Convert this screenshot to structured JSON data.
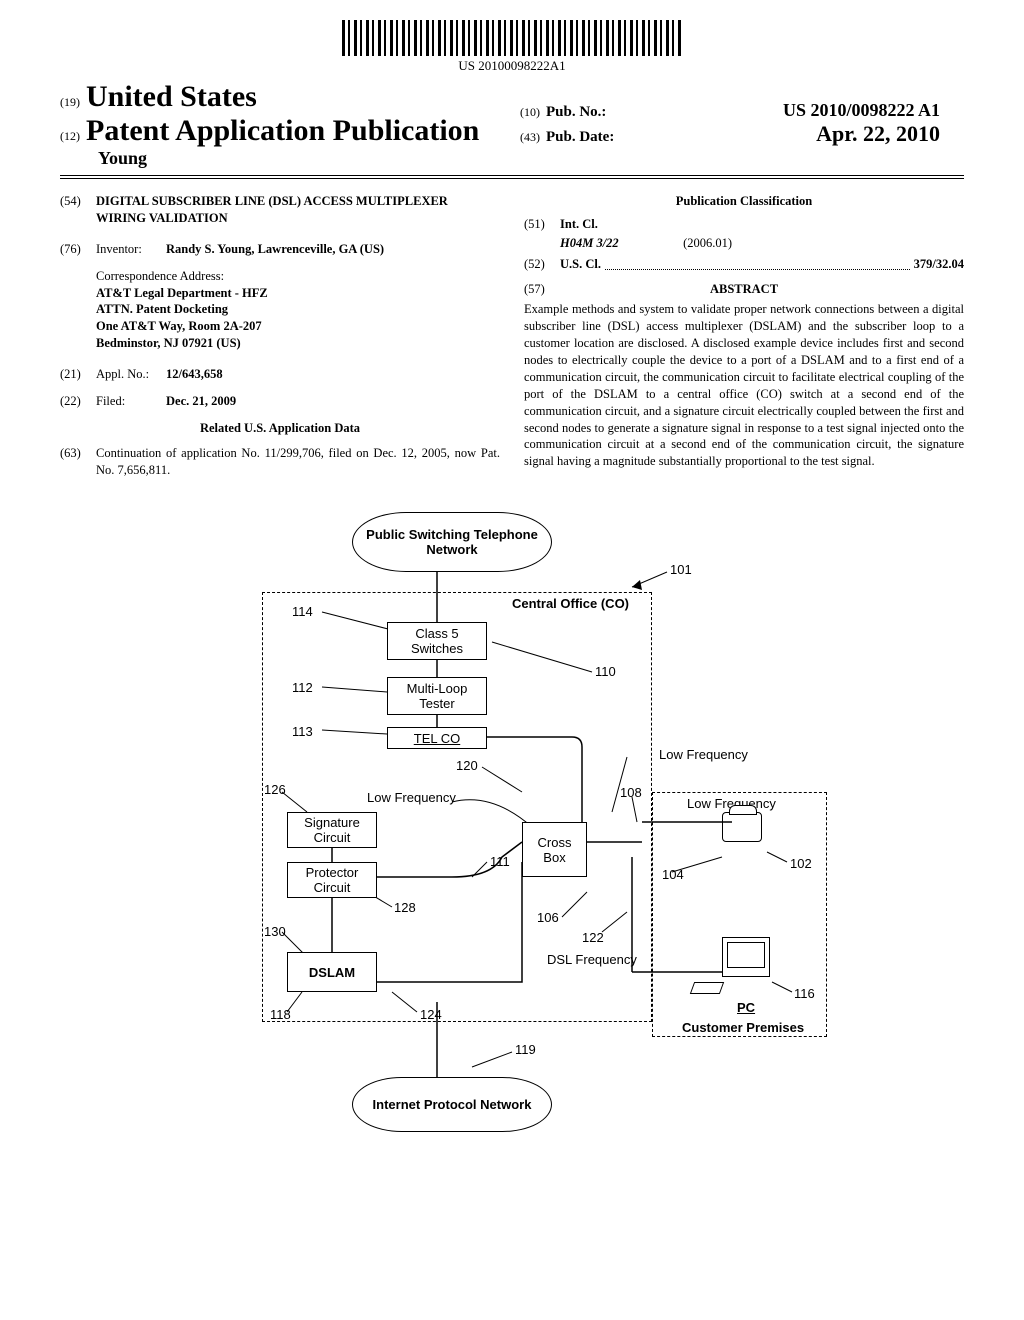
{
  "barcode_text": "US 20100098222A1",
  "header": {
    "country_code": "(19)",
    "country": "United States",
    "pub_type_code": "(12)",
    "pub_type": "Patent Application Publication",
    "inventor_surname": "Young",
    "pub_no_code": "(10)",
    "pub_no_label": "Pub. No.:",
    "pub_no": "US 2010/0098222 A1",
    "pub_date_code": "(43)",
    "pub_date_label": "Pub. Date:",
    "pub_date": "Apr. 22, 2010"
  },
  "left": {
    "title_code": "(54)",
    "title": "DIGITAL SUBSCRIBER LINE (DSL) ACCESS MULTIPLEXER WIRING VALIDATION",
    "inventor_code": "(76)",
    "inventor_label": "Inventor:",
    "inventor": "Randy S. Young, Lawrenceville, GA (US)",
    "corr_label": "Correspondence Address:",
    "corr_1": "AT&T Legal Department - HFZ",
    "corr_2": "ATTN. Patent Docketing",
    "corr_3": "One AT&T Way, Room 2A-207",
    "corr_4": "Bedminstor, NJ 07921 (US)",
    "appl_code": "(21)",
    "appl_label": "Appl. No.:",
    "appl_no": "12/643,658",
    "filed_code": "(22)",
    "filed_label": "Filed:",
    "filed": "Dec. 21, 2009",
    "related_head": "Related U.S. Application Data",
    "related_code": "(63)",
    "related": "Continuation of application No. 11/299,706, filed on Dec. 12, 2005, now Pat. No. 7,656,811."
  },
  "right": {
    "pc_head": "Publication Classification",
    "intcl_code": "(51)",
    "intcl_label": "Int. Cl.",
    "intcl_class": "H04M 3/22",
    "intcl_date": "(2006.01)",
    "uscl_code": "(52)",
    "uscl_label": "U.S. Cl.",
    "uscl_val": "379/32.04",
    "abstract_code": "(57)",
    "abstract_head": "ABSTRACT",
    "abstract": "Example methods and system to validate proper network connections between a digital subscriber line (DSL) access multiplexer (DSLAM) and the subscriber loop to a customer location are disclosed. A disclosed example device includes first and second nodes to electrically couple the device to a port of a DSLAM and to a first end of a communication circuit, the communication circuit to facilitate electrical coupling of the port of the DSLAM to a central office (CO) switch at a second end of the communication circuit, and a signature circuit electrically coupled between the first and second nodes to generate a signature signal in response to a test signal injected onto the communication circuit at a second end of the communication circuit, the signature signal having a magnitude substantially proportional to the test signal."
  },
  "diagram": {
    "pstn": "Public Switching Telephone Network",
    "co_label": "Central Office (CO)",
    "class5": "Class 5 Switches",
    "mlt": "Multi-Loop Tester",
    "telco": "TEL CO",
    "sig": "Signature Circuit",
    "prot": "Protector Circuit",
    "dslam": "DSLAM",
    "crossbox": "Cross Box",
    "ipn": "Internet Protocol Network",
    "lowfreq": "Low Frequency",
    "dslfreq": "DSL Frequency",
    "cust": "Customer Premises",
    "pc": "PC",
    "ref": {
      "r101": "101",
      "r114": "114",
      "r112": "112",
      "r113": "113",
      "r110": "110",
      "r126": "126",
      "r120": "120",
      "r111": "111",
      "r108": "108",
      "r106": "106",
      "r128": "128",
      "r130": "130",
      "r118": "118",
      "r124": "124",
      "r122": "122",
      "r119": "119",
      "r104": "104",
      "r102": "102",
      "r116": "116"
    }
  }
}
